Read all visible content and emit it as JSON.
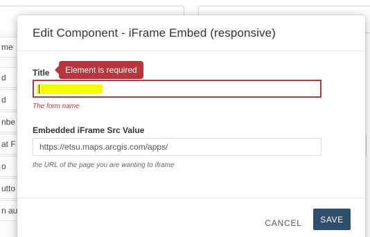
{
  "background": {
    "sidebar_rows": [
      "me",
      "d",
      "d",
      "nbe",
      "at F",
      "o",
      "utto",
      "n au"
    ]
  },
  "modal": {
    "title": "Edit Component - iFrame Embed (responsive)",
    "fields": {
      "title": {
        "label": "Title",
        "value": "",
        "error_tooltip": "Element is required",
        "help": "The form name",
        "state": "invalid"
      },
      "src": {
        "label": "Embedded iFrame Src Value",
        "value": "https://etsu.maps.arcgis.com/apps/",
        "help": "the URL of the page you are wanting to iframe"
      }
    },
    "footer": {
      "cancel_label": "CANCEL",
      "save_label": "SAVE"
    }
  },
  "colors": {
    "error": "#b5373d",
    "primary": "#2f4e6e",
    "highlight": "#f6ff00"
  }
}
